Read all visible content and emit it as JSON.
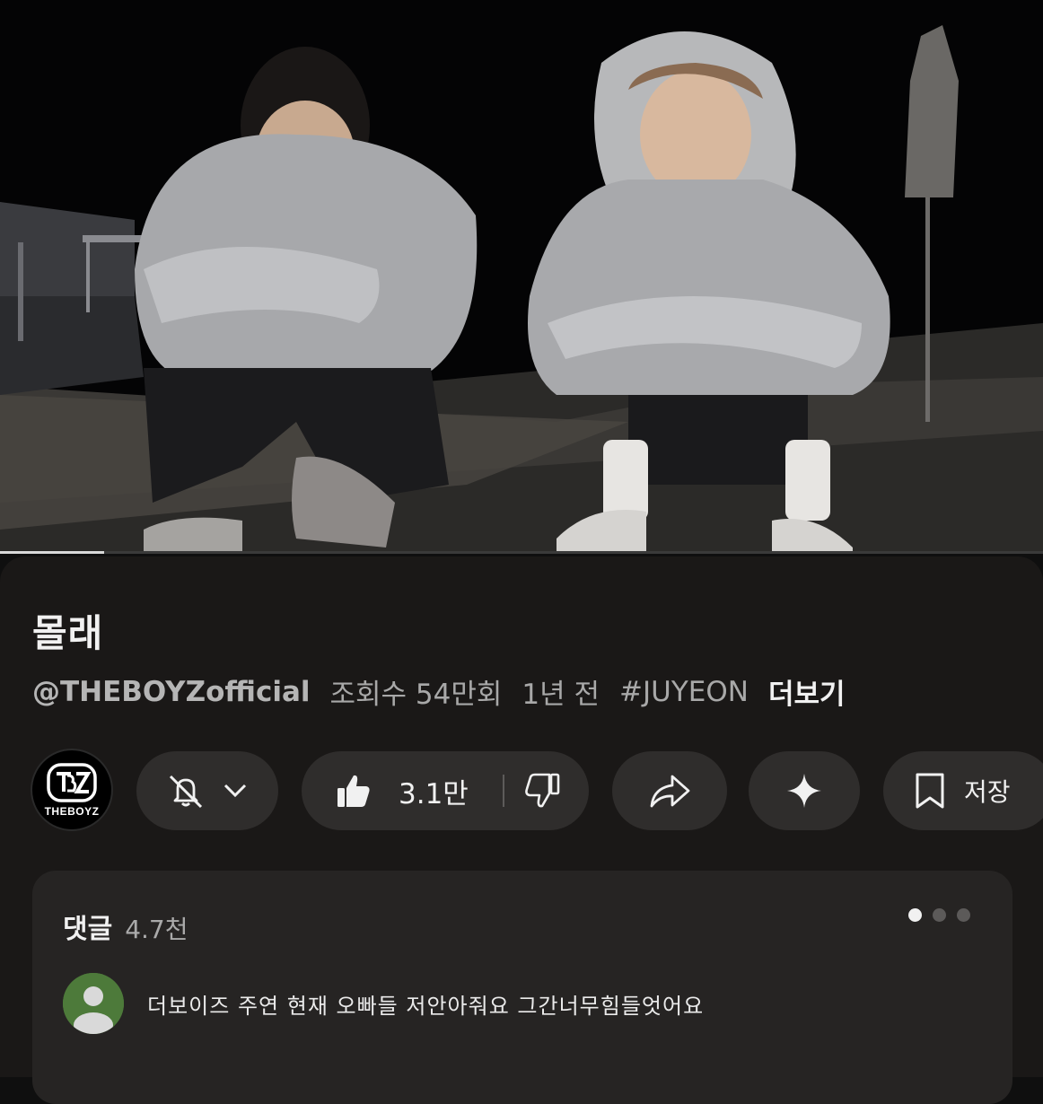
{
  "video": {
    "progress_fraction": 0.1
  },
  "info": {
    "title": "몰래",
    "channel": "@THEBOYZofficial",
    "views": "조회수 54만회",
    "age": "1년 전",
    "hashtag": "#JUYEON",
    "more": "더보기"
  },
  "actions": {
    "avatar_label": "THEBOYZ",
    "likes": "3.1만",
    "save_label": "저장"
  },
  "comments": {
    "title": "댓글",
    "count": "4.7천",
    "first_comment": "더보이즈 주연 현재 오빠들 저안아줘요 그간너무힘들엇어요"
  },
  "colors": {
    "background": "#0f0f0f",
    "panel": "#1a1817",
    "pill": "#2f2d2c",
    "card": "#262423",
    "comment_avatar": "#4d7a3a"
  }
}
